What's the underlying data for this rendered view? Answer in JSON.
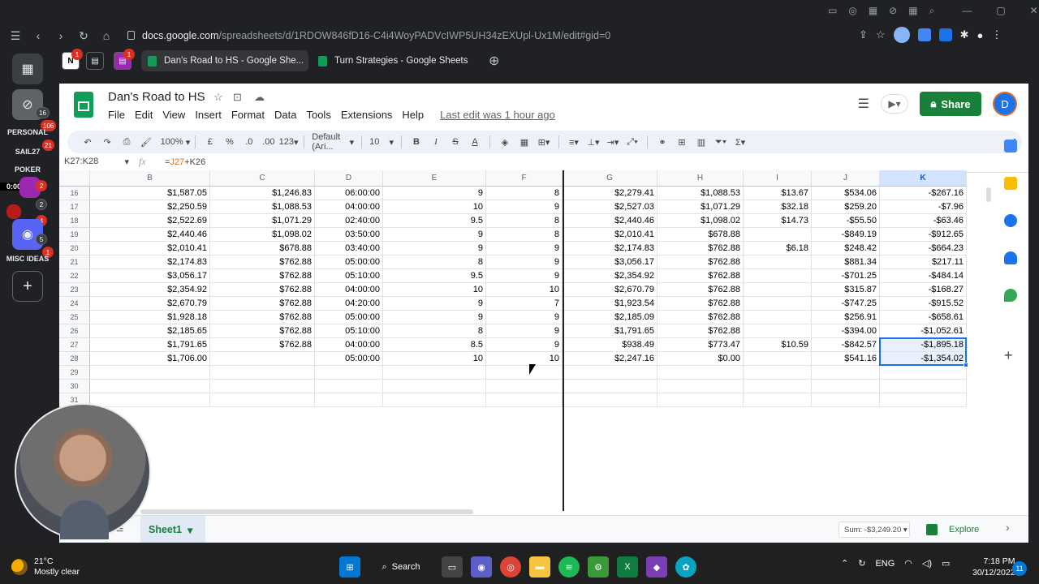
{
  "browser": {
    "url_host": "docs.google.com",
    "url_path": "/spreadsheets/d/1RDOW846fD16-C4i4WoyPADVcIWP5UH34zEXUpl-Ux1M/edit#gid=0",
    "tabs": [
      {
        "label": "Dan's Road to HS - Google She...",
        "active": true
      },
      {
        "label": "Turn Strategies - Google Sheets",
        "active": false
      }
    ],
    "pinned_badges": [
      "1",
      "1"
    ]
  },
  "rail": {
    "badges": [
      "16",
      "106",
      "21",
      "2",
      "2",
      "4",
      "5",
      "1"
    ],
    "labels": {
      "personal": "PERSONAL",
      "sail": "SAIL27",
      "poker": "POKER",
      "timer": "0:00",
      "misc": "MISC IDEAS"
    }
  },
  "sheet": {
    "title": "Dan's Road to HS",
    "menu": [
      "File",
      "Edit",
      "View",
      "Insert",
      "Format",
      "Data",
      "Tools",
      "Extensions",
      "Help"
    ],
    "last_edit": "Last edit was 1 hour ago",
    "share_label": "Share",
    "avatar_letter": "D",
    "toolbar": {
      "zoom": "100%",
      "currency": "£",
      "percent": "%",
      "dec_less": ".0",
      "dec_more": ".00",
      "format": "123",
      "font": "Default (Ari...",
      "size": "10"
    },
    "name_box": "K27:K28",
    "formula": {
      "prefix": "=",
      "ref1": "J27",
      "rest": "+K26"
    },
    "columns": [
      "B",
      "C",
      "D",
      "E",
      "F",
      "G",
      "H",
      "I",
      "J",
      "K"
    ],
    "rows": [
      {
        "n": "16",
        "c": [
          "$1,587.05",
          "$1,246.83",
          "06:00:00",
          "9",
          "8",
          "$2,279.41",
          "$1,088.53",
          "$13.67",
          "$534.06",
          "-$267.16"
        ]
      },
      {
        "n": "17",
        "c": [
          "$2,250.59",
          "$1,088.53",
          "04:00:00",
          "10",
          "9",
          "$2,527.03",
          "$1,071.29",
          "$32.18",
          "$259.20",
          "-$7.96"
        ]
      },
      {
        "n": "18",
        "c": [
          "$2,522.69",
          "$1,071.29",
          "02:40:00",
          "9.5",
          "8",
          "$2,440.46",
          "$1,098.02",
          "$14.73",
          "-$55.50",
          "-$63.46"
        ]
      },
      {
        "n": "19",
        "c": [
          "$2,440.46",
          "$1,098.02",
          "03:50:00",
          "9",
          "8",
          "$2,010.41",
          "$678.88",
          "",
          "-$849.19",
          "-$912.65"
        ]
      },
      {
        "n": "20",
        "c": [
          "$2,010.41",
          "$678.88",
          "03:40:00",
          "9",
          "9",
          "$2,174.83",
          "$762.88",
          "$6.18",
          "$248.42",
          "-$664.23"
        ]
      },
      {
        "n": "21",
        "c": [
          "$2,174.83",
          "$762.88",
          "05:00:00",
          "8",
          "9",
          "$3,056.17",
          "$762.88",
          "",
          "$881.34",
          "$217.11"
        ]
      },
      {
        "n": "22",
        "c": [
          "$3,056.17",
          "$762.88",
          "05:10:00",
          "9.5",
          "9",
          "$2,354.92",
          "$762.88",
          "",
          "-$701.25",
          "-$484.14"
        ]
      },
      {
        "n": "23",
        "c": [
          "$2,354.92",
          "$762.88",
          "04:00:00",
          "10",
          "10",
          "$2,670.79",
          "$762.88",
          "",
          "$315.87",
          "-$168.27"
        ]
      },
      {
        "n": "24",
        "c": [
          "$2,670.79",
          "$762.88",
          "04:20:00",
          "9",
          "7",
          "$1,923.54",
          "$762.88",
          "",
          "-$747.25",
          "-$915.52"
        ]
      },
      {
        "n": "25",
        "c": [
          "$1,928.18",
          "$762.88",
          "05:00:00",
          "9",
          "9",
          "$2,185.09",
          "$762.88",
          "",
          "$256.91",
          "-$658.61"
        ]
      },
      {
        "n": "26",
        "c": [
          "$2,185.65",
          "$762.88",
          "05:10:00",
          "8",
          "9",
          "$1,791.65",
          "$762.88",
          "",
          "-$394.00",
          "-$1,052.61"
        ]
      },
      {
        "n": "27",
        "c": [
          "$1,791.65",
          "$762.88",
          "04:00:00",
          "8.5",
          "9",
          "$938.49",
          "$773.47",
          "$10.59",
          "-$842.57",
          "-$1,895.18"
        ]
      },
      {
        "n": "28",
        "c": [
          "$1,706.00",
          "",
          "05:00:00",
          "10",
          "10",
          "$2,247.16",
          "$0.00",
          "",
          "$541.16",
          "-$1,354.02"
        ]
      },
      {
        "n": "29",
        "c": [
          "",
          "",
          "",
          "",
          "",
          "",
          "",
          "",
          "",
          ""
        ]
      },
      {
        "n": "30",
        "c": [
          "",
          "",
          "",
          "",
          "",
          "",
          "",
          "",
          "",
          ""
        ]
      },
      {
        "n": "31",
        "c": [
          "",
          "",
          "",
          "",
          "",
          "",
          "",
          "",
          "",
          ""
        ]
      }
    ],
    "sheet_tab": "Sheet1",
    "sum": "Sum: -$3,249.20",
    "explore": "Explore"
  },
  "taskbar": {
    "temp": "21°C",
    "weather": "Mostly clear",
    "search": "Search",
    "lang": "ENG",
    "time": "7:18 PM",
    "date": "30/12/2022",
    "notifications": "11"
  }
}
